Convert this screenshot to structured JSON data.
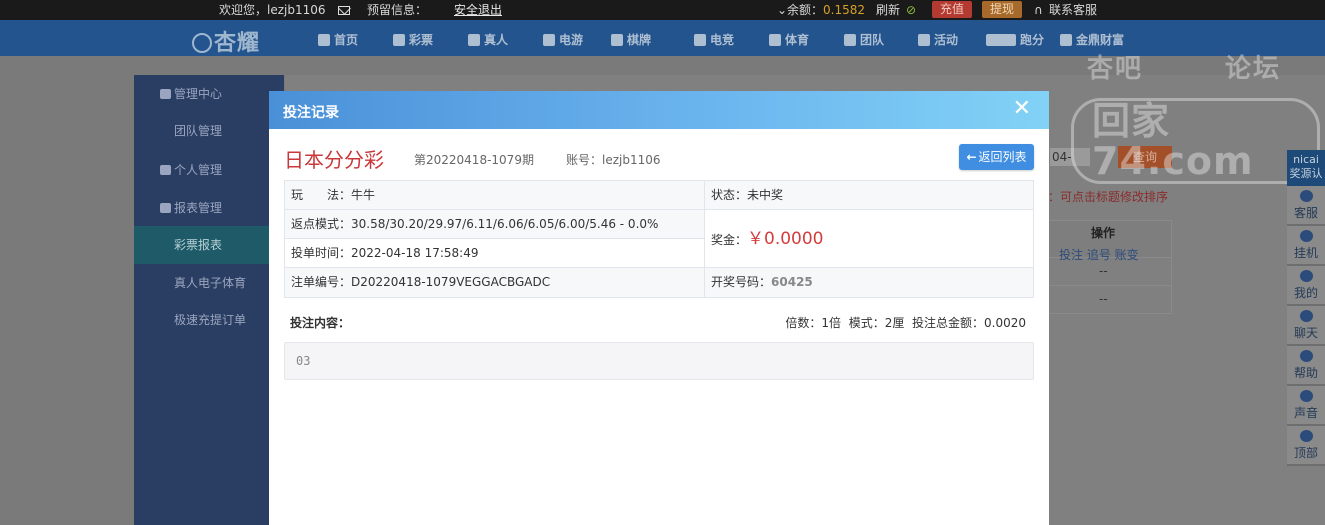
{
  "topbar": {
    "welcome": "欢迎您，lezjb1106",
    "reserved_info": "预留信息：",
    "logout": "安全退出",
    "balance_label": "⌄余额：",
    "balance_value": "0.1582",
    "refresh": "刷新",
    "recharge": "充值",
    "withdraw": "提现",
    "support": "联系客服"
  },
  "nav": {
    "logo": "杏耀",
    "items": [
      "首页",
      "彩票",
      "真人",
      "电游",
      "棋牌",
      "电竞",
      "体育",
      "团队",
      "活动",
      "跑分",
      "金鼎财富"
    ]
  },
  "sidebar": {
    "sections": [
      {
        "label": "管理中心",
        "items": [
          "团队管理"
        ]
      },
      {
        "label": "个人管理",
        "items": []
      },
      {
        "label": "报表管理",
        "items": [
          "彩票报表",
          "真人电子体育",
          "极速充提订单"
        ]
      }
    ],
    "active": "彩票报表"
  },
  "background": {
    "date_fragment": "04-",
    "query_button": "查询",
    "sort_hint": "：可点击标题修改排序",
    "op_header": "操作",
    "op_links": "投注  追号  账变",
    "row_values": [
      "--",
      "--"
    ]
  },
  "right_toolbar": {
    "top_label": "nicai 奖源认",
    "buttons": [
      "客服",
      "挂机",
      "我的",
      "聊天",
      "帮助",
      "声音",
      "顶部"
    ]
  },
  "watermark": {
    "line1_left": "杏吧",
    "line1_right": "论坛",
    "line2": "回家74.com"
  },
  "modal": {
    "title": "投注记录",
    "close": "✕",
    "lottery_name": "日本分分彩",
    "issue": "第20220418-1079期",
    "account": "账号：lezjb1106",
    "back_button": "返回列表",
    "play_label": "玩　　法：",
    "play_value": "牛牛",
    "status_label": "状态：",
    "status_value": "未中奖",
    "rebate_label": "返点模式：",
    "rebate_value": "30.58/30.20/29.97/6.11/6.06/6.05/6.00/5.46 - 0.0%",
    "prize_label": "奖金：",
    "prize_value": "￥0.0000",
    "bet_time_label": "投单时间：",
    "bet_time_value": "2022-04-18 17:58:49",
    "order_no_label": "注单编号：",
    "order_no_value": "D20220418-1079VEGGACBGADC",
    "draw_label": "开奖号码：",
    "draw_value": "60425",
    "bet_content_label": "投注内容：",
    "multiplier_label": "倍数：",
    "multiplier_value": "1倍",
    "mode_label": "模式：",
    "mode_value": "2厘",
    "total_label": "投注总金额：",
    "total_value": "0.0020",
    "bet_content": "03"
  }
}
